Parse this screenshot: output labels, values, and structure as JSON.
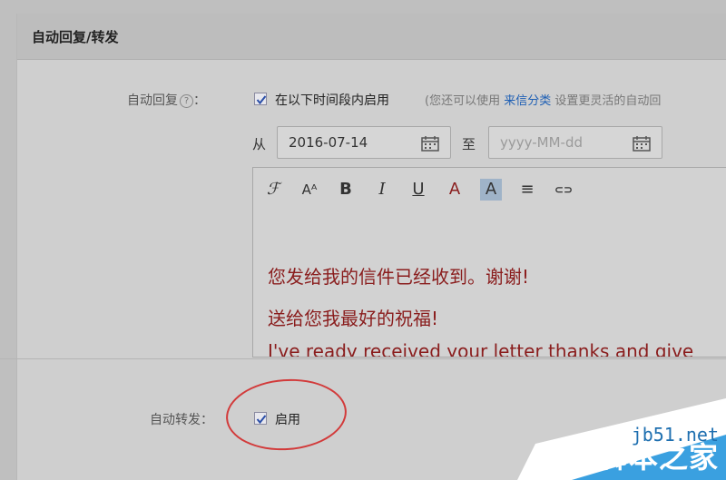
{
  "panel": {
    "title": "自动回复/转发"
  },
  "auto_reply": {
    "label": "自动回复",
    "help_glyph": "?",
    "label_colon": "：",
    "enable_label": "在以下时间段内启用",
    "note_prefix": "(您还可以使用",
    "note_link": "来信分类",
    "note_suffix": "设置更灵活的自动回",
    "checked": true
  },
  "date_range": {
    "from_label": "从",
    "from_value": "2016-07-14",
    "to_label": "至",
    "to_placeholder": "yyyy-MM-dd"
  },
  "editor": {
    "toolbar": [
      {
        "name": "font-family-icon",
        "glyph": "ℱ"
      },
      {
        "name": "font-size-icon",
        "glyph": "Aᴬ"
      },
      {
        "name": "bold-icon",
        "glyph": "B"
      },
      {
        "name": "italic-icon",
        "glyph": "I"
      },
      {
        "name": "underline-icon",
        "glyph": "U"
      },
      {
        "name": "font-color-icon",
        "glyph": "A"
      },
      {
        "name": "background-color-icon",
        "glyph": "A"
      },
      {
        "name": "align-icon",
        "glyph": "≡"
      },
      {
        "name": "link-icon",
        "glyph": "⊂⊃"
      }
    ],
    "lines": [
      "您发给我的信件已经收到。谢谢!",
      "送给您我最好的祝福!",
      "I've ready received your letter thanks and give"
    ],
    "text_color": "#8a1d1d"
  },
  "auto_forward": {
    "label": "自动转发",
    "label_colon": "：",
    "enable_label": "启用",
    "checked": true
  },
  "watermark": {
    "site": "jb51.net",
    "name": "脚本之家"
  },
  "colors": {
    "link": "#1e5fb4",
    "highlight_circle": "#d23a3a",
    "watermark_blue": "#3aa0e0"
  }
}
